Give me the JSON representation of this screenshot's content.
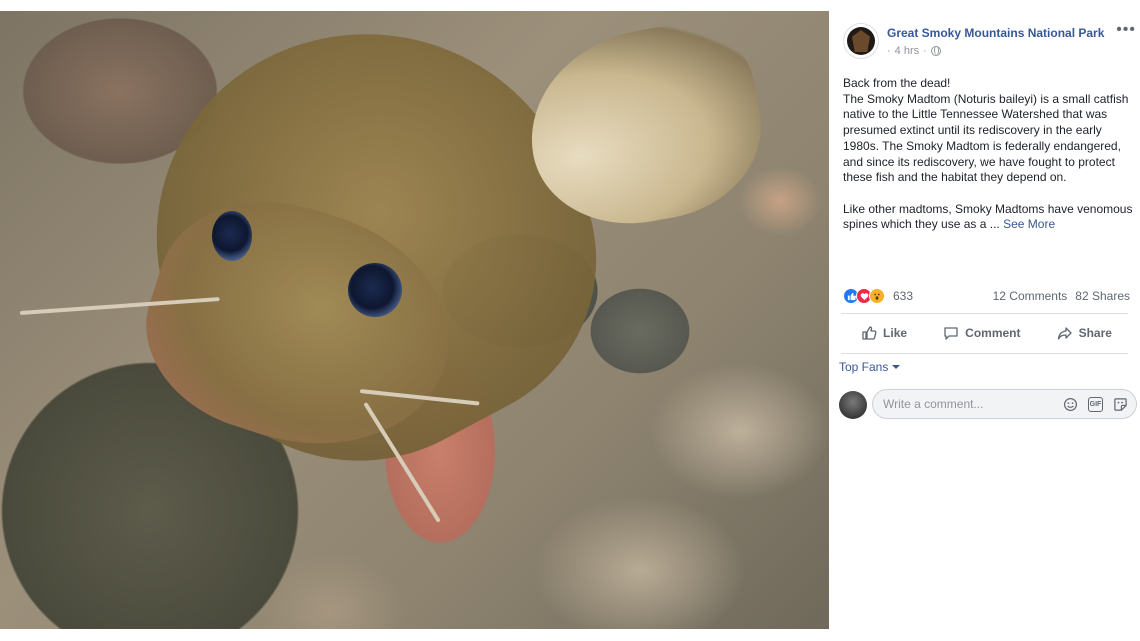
{
  "post": {
    "page_name": "Great Smoky Mountains National Park",
    "time": "4 hrs",
    "privacy_icon": "globe-icon",
    "more_icon": "ellipsis-icon",
    "text": {
      "line1": "Back from the dead!",
      "para1": "The Smoky Madtom (Noturis baileyi) is a small catfish native to the Little Tennessee Watershed that was presumed extinct until its rediscovery in the early 1980s. The Smoky Madtom is federally endangered, and since its rediscovery, we have fought to protect these fish and the habitat they depend on.",
      "para2": "Like other madtoms, Smoky Madtoms have venomous spines which they use as a",
      "ellipsis": "...",
      "see_more": "See More"
    }
  },
  "reactions": {
    "count": "633",
    "comments": "12 Comments",
    "shares": "82 Shares",
    "icons": [
      "like-icon",
      "love-icon",
      "wow-icon"
    ]
  },
  "actions": {
    "like": "Like",
    "comment": "Comment",
    "share": "Share"
  },
  "comments": {
    "filter": "Top Fans",
    "placeholder": "Write a comment...",
    "icons": [
      "emoji-icon",
      "gif-icon",
      "sticker-icon"
    ],
    "gif_label": "GIF"
  },
  "colors": {
    "link": "#365899",
    "meta": "#90949c",
    "like": "#2078f4",
    "love": "#f0284a",
    "wow": "#f7b125"
  }
}
